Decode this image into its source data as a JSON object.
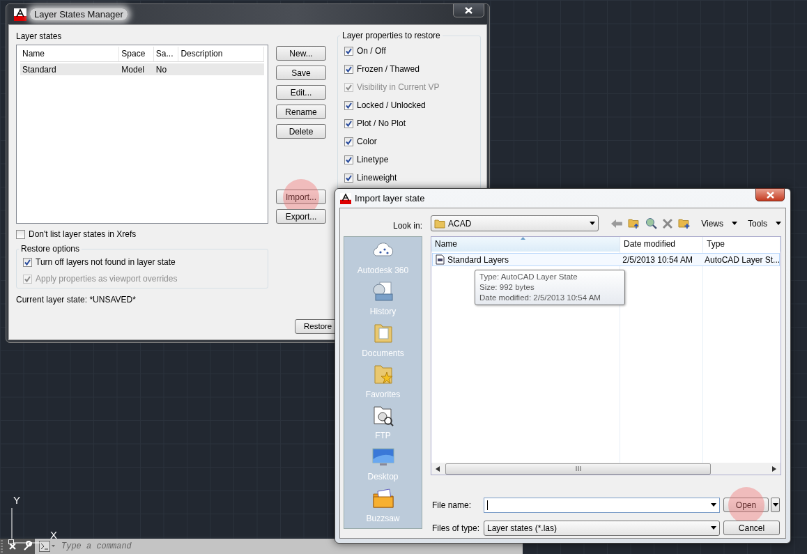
{
  "canvas": {
    "ucs_y_label": "Y",
    "ucs_x_label": "X"
  },
  "layer_states_manager": {
    "title": "Layer States Manager",
    "layer_states_label": "Layer states",
    "table": {
      "columns": [
        "Name",
        "Space",
        "Sa...",
        "Description"
      ],
      "rows": [
        {
          "cells": [
            "Standard",
            "Model",
            "No",
            ""
          ],
          "selected": true
        }
      ]
    },
    "buttons": [
      {
        "label": "New...",
        "click_marker": false
      },
      {
        "label": "Save",
        "click_marker": false
      },
      {
        "label": "Edit...",
        "click_marker": false
      },
      {
        "label": "Rename",
        "click_marker": false
      },
      {
        "label": "Delete",
        "click_marker": false
      }
    ],
    "transfer_buttons": [
      {
        "label": "Import...",
        "click_marker": true
      },
      {
        "label": "Export...",
        "click_marker": false
      }
    ],
    "xref_option": {
      "label": "Don't list layer states in Xrefs",
      "checked": false,
      "disabled": false
    },
    "restore_options": {
      "title": "Restore options",
      "options": [
        {
          "label": "Turn off layers not found in layer state",
          "checked": true,
          "disabled": false
        },
        {
          "label": "Apply properties as viewport overrides",
          "checked": true,
          "disabled": true
        }
      ]
    },
    "current_state": "Current layer state: *UNSAVED*",
    "restore_button": "Restore",
    "properties": {
      "title": "Layer properties to restore",
      "options": [
        {
          "label": "On / Off",
          "checked": true,
          "disabled": false
        },
        {
          "label": "Frozen / Thawed",
          "checked": true,
          "disabled": false
        },
        {
          "label": "Visibility in Current VP",
          "checked": true,
          "disabled": true
        },
        {
          "label": "Locked / Unlocked",
          "checked": true,
          "disabled": false
        },
        {
          "label": "Plot / No Plot",
          "checked": true,
          "disabled": false
        },
        {
          "label": "Color",
          "checked": true,
          "disabled": false
        },
        {
          "label": "Linetype",
          "checked": true,
          "disabled": false
        },
        {
          "label": "Lineweight",
          "checked": true,
          "disabled": false
        }
      ]
    }
  },
  "import_dialog": {
    "title": "Import layer state",
    "look_in_label": "Look in:",
    "look_in_value": "ACAD",
    "menus": [
      "Views",
      "Tools"
    ],
    "places": [
      {
        "label": "Autodesk 360"
      },
      {
        "label": "History"
      },
      {
        "label": "Documents"
      },
      {
        "label": "Favorites"
      },
      {
        "label": "FTP"
      },
      {
        "label": "Desktop"
      },
      {
        "label": "Buzzsaw"
      }
    ],
    "columns": [
      {
        "label": "Name",
        "sorted": true
      },
      {
        "label": "Date modified",
        "sorted": false
      },
      {
        "label": "Type",
        "sorted": false
      }
    ],
    "files": [
      {
        "name": "Standard Layers",
        "date": "2/5/2013 10:54 AM",
        "type": "AutoCAD Layer St...",
        "hovered": true
      }
    ],
    "tooltip": [
      "Type: AutoCAD Layer State",
      "Size: 992 bytes",
      "Date modified: 2/5/2013 10:54 AM"
    ],
    "file_name_label": "File name:",
    "files_of_type_label": "Files of type:",
    "files_of_type_value": "Layer states (*.las)",
    "open_button": {
      "label": "Open",
      "click_marker": true
    },
    "cancel_button": {
      "label": "Cancel"
    }
  },
  "command_line": {
    "placeholder": "Type a command"
  }
}
